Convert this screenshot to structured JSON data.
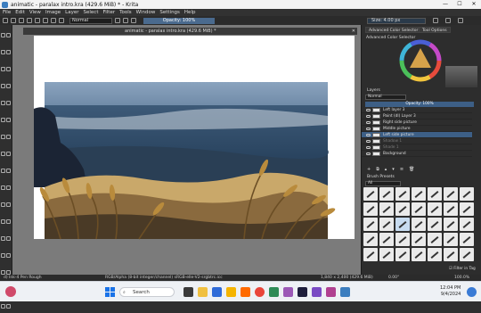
{
  "window": {
    "title": "animatic - paralax intro.kra (429.6 MiB) * - Krita",
    "controls": [
      "—",
      "☐",
      "✕"
    ]
  },
  "menu": [
    "File",
    "Edit",
    "View",
    "Image",
    "Layer",
    "Select",
    "Filter",
    "Tools",
    "Window",
    "Settings",
    "Help"
  ],
  "toolbar": {
    "blend_mode": "Normal",
    "opacity": "Opacity: 100%",
    "size": "Size: 4.00 px"
  },
  "document": {
    "tab_title": "animatic - paralax intro.kra (429.6 MiB) *"
  },
  "right_panel": {
    "tabs": [
      "Advanced Color Selector",
      "Tool Options"
    ],
    "color_selector_title": "Advanced Color Selector",
    "layers_title": "Layers",
    "layers_blend": "Normal",
    "layers_opacity": "Opacity: 100%",
    "layers": [
      {
        "name": "Left layer 3",
        "selected": false,
        "dim": false
      },
      {
        "name": "Paint (dl) Layer 3",
        "selected": false,
        "dim": false
      },
      {
        "name": "Right side picture",
        "selected": false,
        "dim": false
      },
      {
        "name": "Middle picture",
        "selected": false,
        "dim": false
      },
      {
        "name": "Left side picture",
        "selected": true,
        "dim": false
      },
      {
        "name": "Shadow 1",
        "selected": false,
        "dim": true
      },
      {
        "name": "Shade 1",
        "selected": false,
        "dim": true
      },
      {
        "name": "Background",
        "selected": false,
        "dim": false
      }
    ],
    "brush_presets_title": "Brush Presets",
    "brush_tag": "All",
    "filter_label": "Filter in Tag"
  },
  "status": {
    "brush": "d) Ink-4 Pen Rough",
    "color": "RGB/Alpha (8-bit integer/channel)  sRGB-elle-V2-srgbtrc.icc",
    "dims": "1,840 x 2,400 (429.6 MiB)",
    "rotation": "0.00°",
    "zoom": "100.0%"
  },
  "taskbar": {
    "search_placeholder": "Search",
    "time": "12:04 PM",
    "date": "9/4/2024"
  },
  "colors": {
    "accent": "#3d5f86",
    "panel": "#2d2d2d",
    "canvas_bg": "#7b7b7b"
  }
}
